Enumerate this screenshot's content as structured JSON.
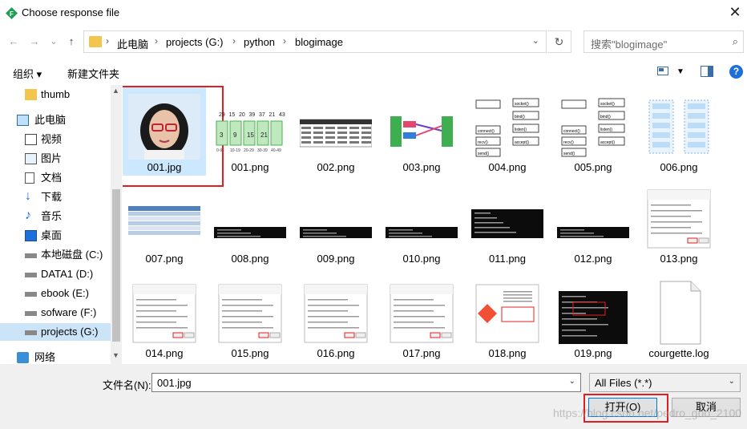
{
  "window": {
    "title": "Choose response file",
    "close_symbol": "✕"
  },
  "nav": {
    "back": "←",
    "forward": "→",
    "dropdown": "⌄",
    "up": "↑"
  },
  "address": {
    "crumbs": [
      "此电脑",
      "projects (G:)",
      "python",
      "blogimage"
    ],
    "separator": "›",
    "dropdown": "⌄",
    "refresh": "↻"
  },
  "search": {
    "placeholder": "搜索\"blogimage\"",
    "icon": "⌕"
  },
  "toolbar": {
    "organize": "组织 ▾",
    "new_folder": "新建文件夹",
    "help": "?"
  },
  "sidebar": {
    "items": [
      {
        "label": "thumb",
        "icon": "folder-icon"
      },
      {
        "label": "此电脑",
        "icon": "computer-icon"
      },
      {
        "label": "视频",
        "icon": "video-icon"
      },
      {
        "label": "图片",
        "icon": "pictures-icon"
      },
      {
        "label": "文档",
        "icon": "documents-icon"
      },
      {
        "label": "下载",
        "icon": "download-icon"
      },
      {
        "label": "音乐",
        "icon": "music-icon"
      },
      {
        "label": "桌面",
        "icon": "desktop-icon"
      },
      {
        "label": "本地磁盘 (C:)",
        "icon": "drive-icon"
      },
      {
        "label": "DATA1 (D:)",
        "icon": "drive-icon"
      },
      {
        "label": "ebook (E:)",
        "icon": "drive-icon"
      },
      {
        "label": "sofware (F:)",
        "icon": "drive-icon"
      },
      {
        "label": "projects (G:)",
        "icon": "drive-icon",
        "selected": true
      },
      {
        "label": "网络",
        "icon": "network-icon"
      }
    ]
  },
  "files": [
    {
      "name": "001.jpg",
      "kind": "photo",
      "selected": true
    },
    {
      "name": "001.png",
      "kind": "array"
    },
    {
      "name": "002.png",
      "kind": "table"
    },
    {
      "name": "003.png",
      "kind": "diagram-color"
    },
    {
      "name": "004.png",
      "kind": "socket"
    },
    {
      "name": "005.png",
      "kind": "socket"
    },
    {
      "name": "006.png",
      "kind": "flow-blue"
    },
    {
      "name": "007.png",
      "kind": "bluetable"
    },
    {
      "name": "008.png",
      "kind": "terminal-small"
    },
    {
      "name": "009.png",
      "kind": "terminal-small"
    },
    {
      "name": "010.png",
      "kind": "terminal-small"
    },
    {
      "name": "011.png",
      "kind": "terminal"
    },
    {
      "name": "012.png",
      "kind": "terminal-small"
    },
    {
      "name": "013.png",
      "kind": "dialog"
    },
    {
      "name": "014.png",
      "kind": "dialog"
    },
    {
      "name": "015.png",
      "kind": "dialog"
    },
    {
      "name": "016.png",
      "kind": "dialog"
    },
    {
      "name": "017.png",
      "kind": "dialog"
    },
    {
      "name": "018.png",
      "kind": "installer"
    },
    {
      "name": "019.png",
      "kind": "terminal-red"
    },
    {
      "name": "courgette.log",
      "kind": "document"
    }
  ],
  "array_thumb": {
    "top": [
      "29",
      "15",
      "20",
      "39",
      "37",
      "21",
      "43"
    ],
    "cells": [
      "3",
      "9",
      "15",
      "21"
    ],
    "labels": [
      "0-9",
      "10-19",
      "20-29",
      "30-39",
      "40-49"
    ]
  },
  "socket_thumb": {
    "lines": [
      "socket()",
      "bind()",
      "listen()",
      "accept()",
      "connect()",
      "recv()",
      "send()"
    ]
  },
  "filename": {
    "label": "文件名(N):",
    "value": "001.jpg",
    "dropdown": "⌄"
  },
  "filetype": {
    "value": "All Files (*.*)",
    "dropdown": "⌄"
  },
  "buttons": {
    "open": "打开(O)",
    "cancel": "取消"
  },
  "watermark": "https://blog.csdn.net/pedro_guo_2100",
  "colors": {
    "selection": "#cce8ff",
    "highlight_box": "#e02020",
    "accent": "#0078d7"
  }
}
